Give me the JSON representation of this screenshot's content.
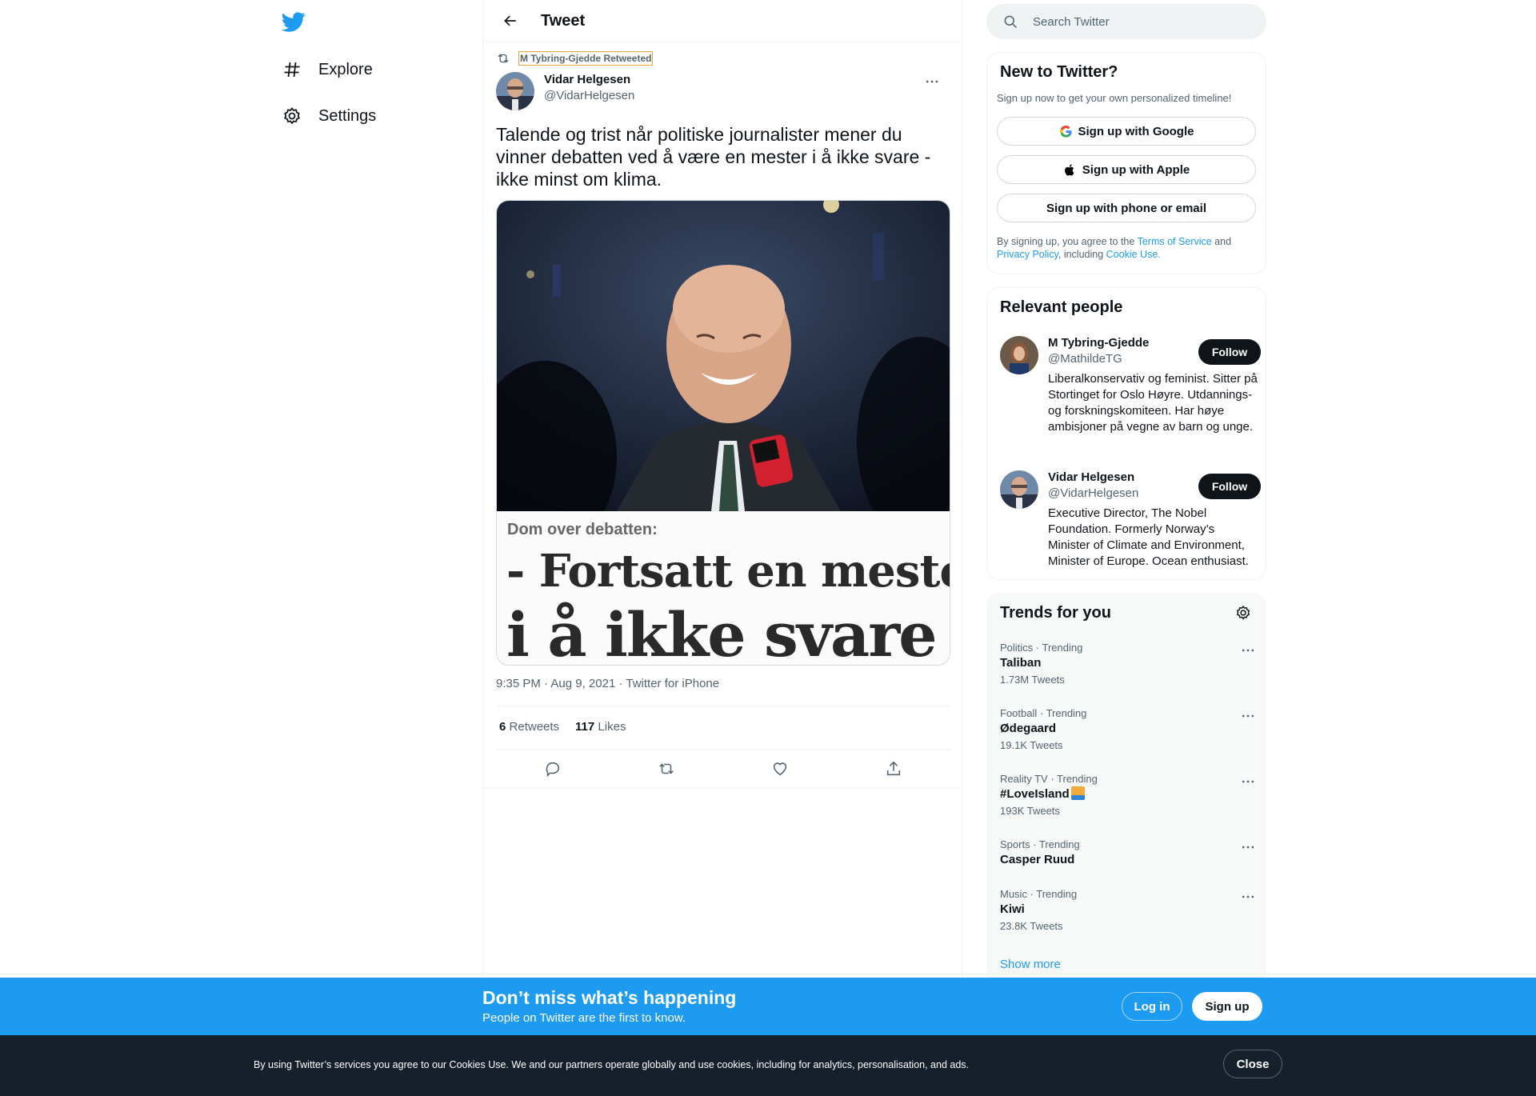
{
  "colors": {
    "accent": "#1d9bf0",
    "text": "#0f1419",
    "muted": "#536471",
    "banner": "#1d9bf0",
    "cookie_bg": "#15202b"
  },
  "nav": {
    "logo_icon": "twitter-bird-icon",
    "items": [
      {
        "label": "Explore",
        "icon": "hashtag-icon"
      },
      {
        "label": "Settings",
        "icon": "gear-icon"
      }
    ]
  },
  "header": {
    "title": "Tweet",
    "back_icon": "arrow-left-icon"
  },
  "tweet": {
    "retweeted_by": "M Tybring-Gjedde Retweeted",
    "author_name": "Vidar Helgesen",
    "author_handle": "@VidarHelgesen",
    "text": "Talende og trist når politiske journalister mener du vinner debatten ved å være en mester i å ikke svare - ikke minst om klima.",
    "media_caption_small": "Dom over debatten:",
    "media_caption_line1": "- Fortsatt en mester",
    "media_caption_line2": "i å ikke svare",
    "time": "9:35 PM",
    "date": "Aug 9, 2021",
    "source": "Twitter for iPhone",
    "sep": "·",
    "retweets_count": "6",
    "retweets_label": "Retweets",
    "likes_count": "117",
    "likes_label": "Likes"
  },
  "search": {
    "placeholder": "Search Twitter"
  },
  "new_to_twitter": {
    "title": "New to Twitter?",
    "subtitle": "Sign up now to get your own personalized timeline!",
    "google": "Sign up with Google",
    "apple": "Sign up with Apple",
    "phone": "Sign up with phone or email",
    "legal_pre": "By signing up, you agree to the",
    "terms": "Terms of Service",
    "and": "and",
    "privacy": "Privacy Policy",
    "including": ", including",
    "cookie": "Cookie Use."
  },
  "relevant": {
    "title": "Relevant people",
    "people": [
      {
        "name": "M Tybring-Gjedde",
        "handle": "@MathildeTG",
        "follow": "Follow",
        "bio": "Liberalkonservativ og feminist. Sitter på Stortinget for Oslo Høyre. Utdannings- og forskningskomiteen. Har høye ambisjoner på vegne av barn og unge."
      },
      {
        "name": "Vidar Helgesen",
        "handle": "@VidarHelgesen",
        "follow": "Follow",
        "bio": "Executive Director, The Nobel Foundation. Formerly Norway’s Minister of Climate and Environment, Minister of Europe. Ocean enthusiast."
      }
    ]
  },
  "trends": {
    "title": "Trends for you",
    "items": [
      {
        "meta": "Politics · Trending",
        "name": "Taliban",
        "count": "1.73M Tweets"
      },
      {
        "meta": "Football · Trending",
        "name": "Ødegaard",
        "count": "19.1K Tweets"
      },
      {
        "meta": "Reality TV · Trending",
        "name": "#LoveIsland",
        "count": "193K Tweets"
      },
      {
        "meta": "Sports · Trending",
        "name": "Casper Ruud",
        "count": ""
      },
      {
        "meta": "Music · Trending",
        "name": "Kiwi",
        "count": "23.8K Tweets"
      }
    ],
    "show_more": "Show more"
  },
  "banner": {
    "title": "Don’t miss what’s happening",
    "subtitle": "People on Twitter are the first to know.",
    "login": "Log in",
    "signup": "Sign up"
  },
  "cookie": {
    "text": "By using Twitter’s services you agree to our Cookies Use. We and our partners operate globally and use cookies, including for analytics, personalisation, and ads.",
    "close": "Close"
  }
}
